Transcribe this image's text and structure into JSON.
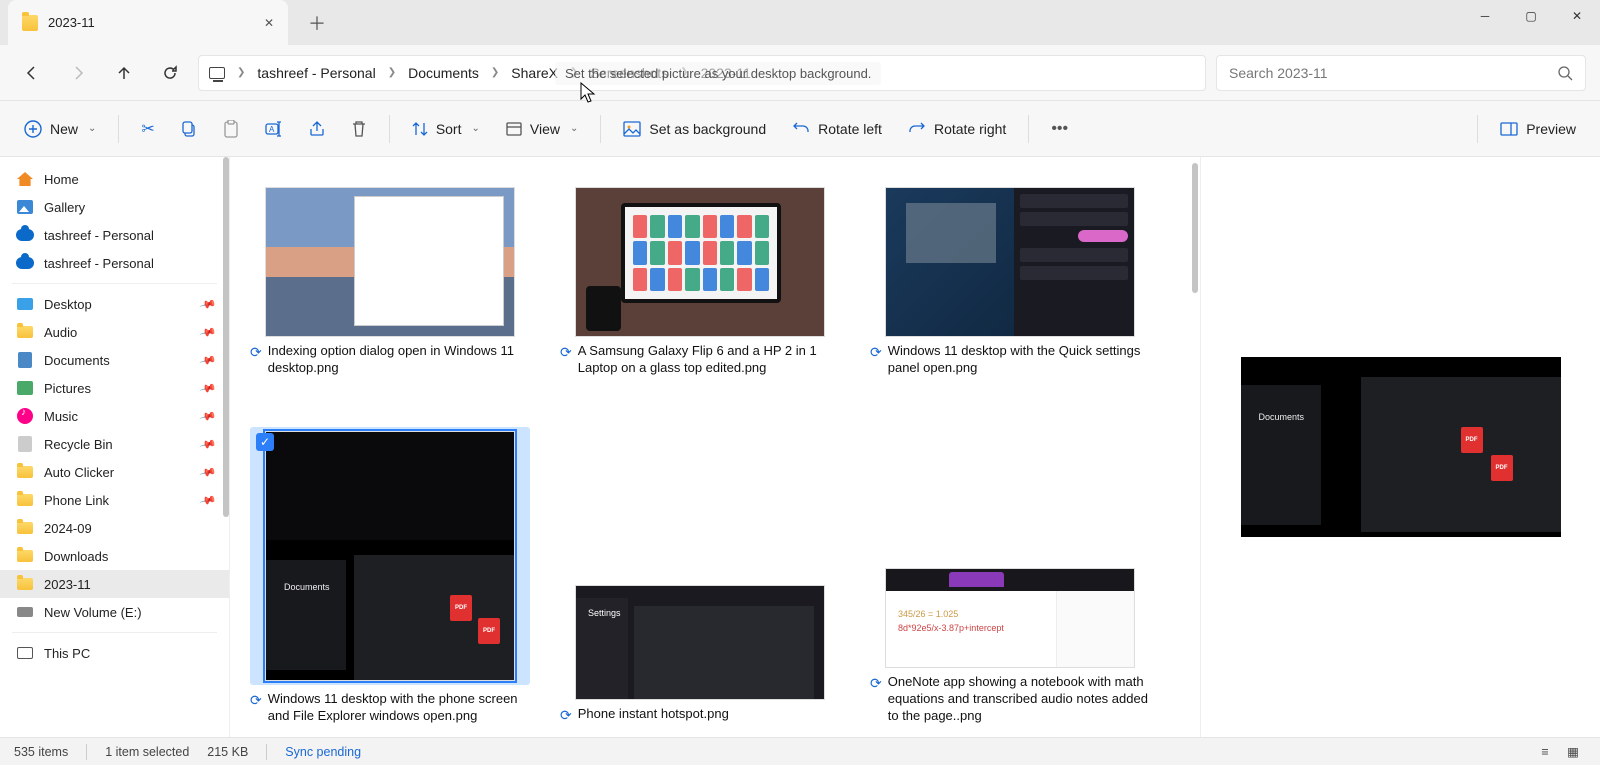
{
  "titlebar": {
    "tab_title": "2023-11"
  },
  "breadcrumb": {
    "root": "tashreef - Personal",
    "p1": "Documents",
    "p2": "ShareX",
    "p3": "Screenshots",
    "p4": "2023-11"
  },
  "search": {
    "placeholder": "Search 2023-11"
  },
  "toolbar": {
    "new": "New",
    "sort": "Sort",
    "view": "View",
    "background": "Set as background",
    "rotate_left": "Rotate left",
    "rotate_right": "Rotate right",
    "preview": "Preview"
  },
  "tooltip": {
    "text": "Set the selected picture as your desktop background."
  },
  "sidebar": {
    "home": "Home",
    "gallery": "Gallery",
    "od1": "tashreef - Personal",
    "od2": "tashreef - Personal",
    "desktop": "Desktop",
    "audio": "Audio",
    "documents": "Documents",
    "pictures": "Pictures",
    "music": "Music",
    "recycle": "Recycle Bin",
    "autoclicker": "Auto Clicker",
    "phonelink": "Phone Link",
    "f2024": "2024-09",
    "downloads": "Downloads",
    "f2023": "2023-11",
    "volume": "New Volume (E:)",
    "thispc": "This PC"
  },
  "files": {
    "f0": "Indexing option dialog open in Windows 11 desktop.png",
    "f1": "A Samsung Galaxy Flip 6 and a HP 2 in 1 Laptop on a glass top edited.png",
    "f2": "Windows 11 desktop with the Quick settings panel open.png",
    "f3": "Windows 11 desktop with the phone screen and File Explorer windows open.png",
    "f4": "Phone instant hotspot.png",
    "f5": "OneNote app showing a notebook with math equations and transcribed audio notes added to the page..png"
  },
  "status": {
    "count": "535 items",
    "selected": "1 item selected",
    "size": "215 KB",
    "sync": "Sync pending"
  }
}
